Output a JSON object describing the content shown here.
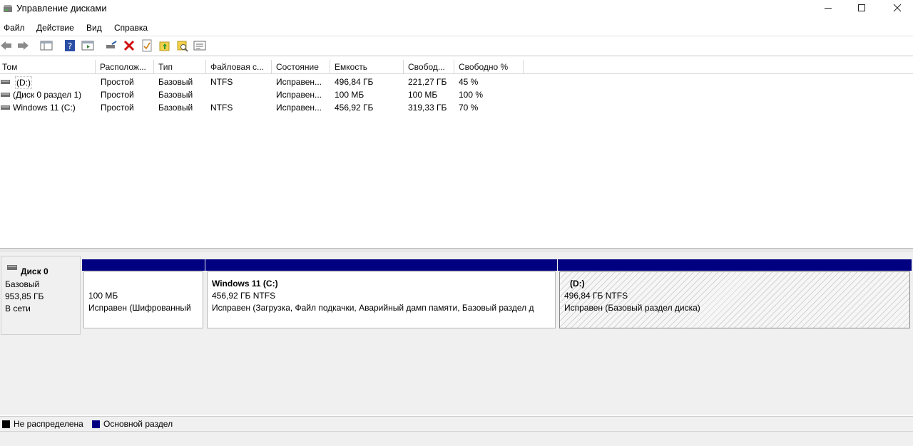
{
  "window": {
    "title": "Управление дисками"
  },
  "menu": [
    "Файл",
    "Действие",
    "Вид",
    "Справка"
  ],
  "toolbar": [
    "back-icon",
    "forward-icon",
    "console-tree-icon",
    "help-icon",
    "show-pane-icon",
    "connect-disk-icon",
    "delete-icon",
    "properties-icon",
    "folder-up-icon",
    "folder-search-icon",
    "settings-list-icon"
  ],
  "columns": [
    "Том",
    "Располож...",
    "Тип",
    "Файловая с...",
    "Состояние",
    "Емкость",
    "Свобод...",
    "Свободно %"
  ],
  "volumes": [
    {
      "name": "(D:)",
      "layout": "Простой",
      "type": "Базовый",
      "fs": "NTFS",
      "status": "Исправен...",
      "capacity": "496,84 ГБ",
      "free": "221,27 ГБ",
      "free_pct": "45 %"
    },
    {
      "name": "(Диск 0 раздел 1)",
      "layout": "Простой",
      "type": "Базовый",
      "fs": "",
      "status": "Исправен...",
      "capacity": "100 МБ",
      "free": "100 МБ",
      "free_pct": "100 %"
    },
    {
      "name": "Windows 11 (C:)",
      "layout": "Простой",
      "type": "Базовый",
      "fs": "NTFS",
      "status": "Исправен...",
      "capacity": "456,92 ГБ",
      "free": "319,33 ГБ",
      "free_pct": "70 %"
    }
  ],
  "disk": {
    "name": "Диск 0",
    "type": "Базовый",
    "size": "953,85 ГБ",
    "state": "В сети",
    "partitions": [
      {
        "title": "",
        "size": "100 МБ",
        "status": "Исправен (Шифрованный"
      },
      {
        "title": "Windows 11  (C:)",
        "size": "456,92 ГБ NTFS",
        "status": "Исправен (Загрузка, Файл подкачки, Аварийный дамп памяти, Базовый раздел д"
      },
      {
        "title": "(D:)",
        "size": "496,84 ГБ NTFS",
        "status": "Исправен (Базовый раздел диска)"
      }
    ]
  },
  "legend": [
    {
      "label": "Не распределена",
      "color": "#000000"
    },
    {
      "label": "Основной раздел",
      "color": "#000080"
    }
  ]
}
